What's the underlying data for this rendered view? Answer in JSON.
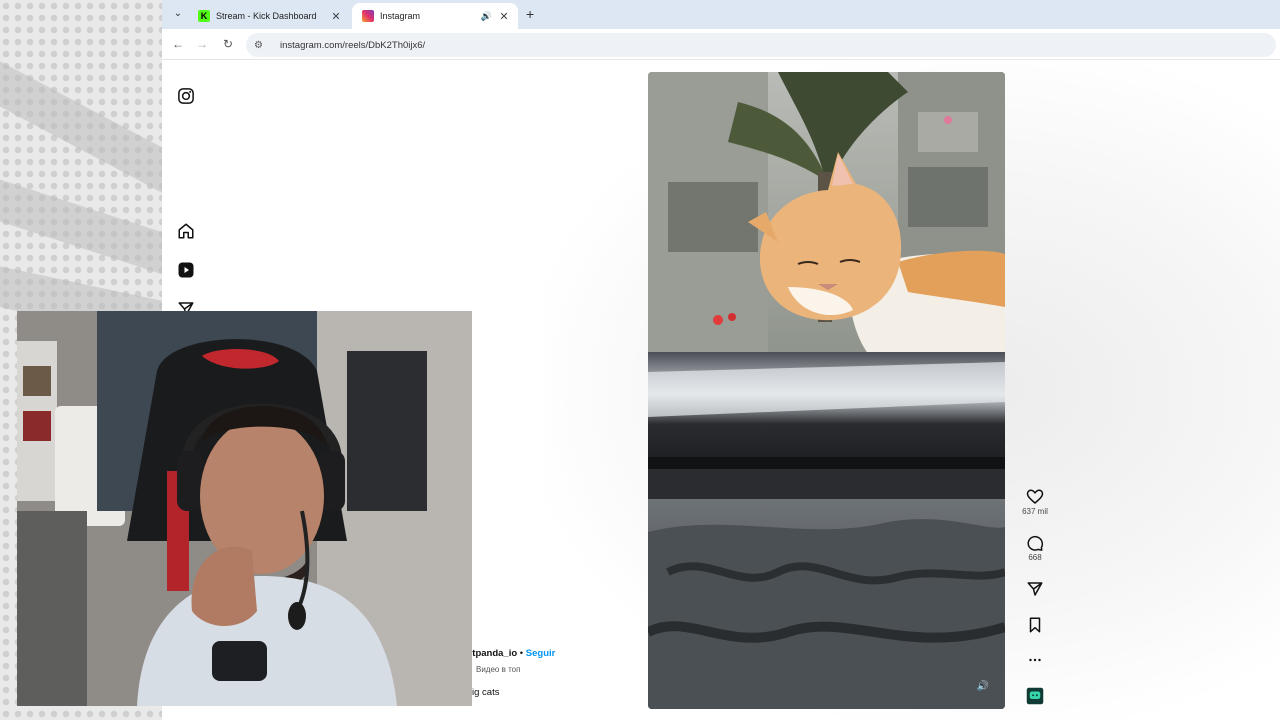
{
  "browser": {
    "tabs": [
      {
        "title": "Stream - Kick Dashboard",
        "favicon": "kick-logo",
        "active": false
      },
      {
        "title": "Instagram",
        "favicon": "instagram-logo",
        "active": true,
        "audio": true
      }
    ],
    "url": "instagram.com/reels/DbK2Th0ijx6/"
  },
  "instagram": {
    "sidebar": [
      "instagram-logo-icon",
      "home-icon",
      "reels-icon",
      "messages-icon"
    ],
    "reel": {
      "likes": "637 mil",
      "comments": "668",
      "username": "etpanda_io",
      "separator": "•",
      "follow_label": "Seguir",
      "subtitle": "Видео в топ",
      "caption": "ig cats"
    }
  },
  "colors": {
    "chrome_tab_strip": "#dde6f3",
    "follow_blue": "#0095f6",
    "kick_green": "#53fc18"
  }
}
